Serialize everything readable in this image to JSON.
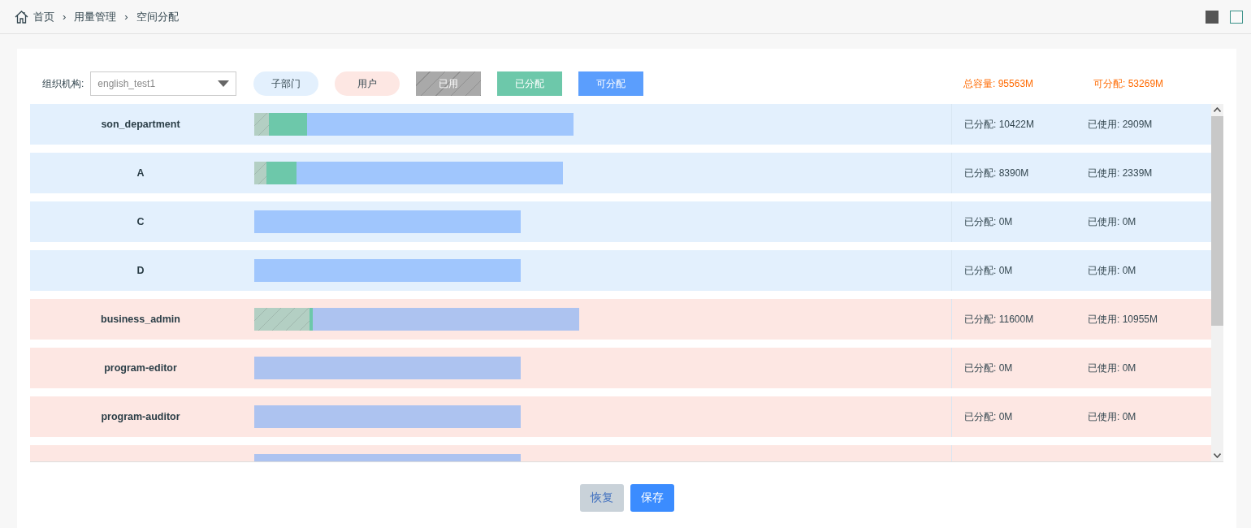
{
  "breadcrumb": [
    {
      "label": "首页"
    },
    {
      "label": "用量管理"
    },
    {
      "label": "空间分配"
    }
  ],
  "breadcrumb_separator": "›",
  "view_toggle": [
    {
      "selected": true
    },
    {
      "selected": false
    }
  ],
  "org_select": {
    "label": "组织机构:",
    "value": "english_test1"
  },
  "legend": [
    {
      "kind": "department",
      "label": "子部门"
    },
    {
      "kind": "user",
      "label": "用户"
    },
    {
      "kind": "used",
      "label": "已用"
    },
    {
      "kind": "allocated",
      "label": "已分配"
    },
    {
      "kind": "available",
      "label": "可分配"
    }
  ],
  "totals": [
    {
      "label": "总容量:",
      "value": "95563M"
    },
    {
      "label": "可分配:",
      "value": "53269M"
    }
  ],
  "rows": [
    {
      "kind": "department",
      "name": "son_department",
      "segments": [
        {
          "kind": "used"
        },
        {
          "kind": "allocated"
        },
        {
          "kind": "available"
        }
      ],
      "allocated": "已分配: 10422M",
      "used": "已使用: 2909M"
    },
    {
      "kind": "department",
      "name": "A",
      "segments": [
        {
          "kind": "used"
        },
        {
          "kind": "allocated"
        },
        {
          "kind": "available"
        }
      ],
      "allocated": "已分配: 8390M",
      "used": "已使用: 2339M"
    },
    {
      "kind": "department",
      "name": "C",
      "segments": [
        {
          "kind": "available"
        }
      ],
      "allocated": "已分配: 0M",
      "used": "已使用: 0M"
    },
    {
      "kind": "department",
      "name": "D",
      "segments": [
        {
          "kind": "available"
        }
      ],
      "allocated": "已分配: 0M",
      "used": "已使用: 0M"
    },
    {
      "kind": "user",
      "name": "business_admin",
      "segments": [
        {
          "kind": "used"
        },
        {
          "kind": "allocated"
        },
        {
          "kind": "available"
        }
      ],
      "allocated": "已分配: 11600M",
      "used": "已使用: 10955M"
    },
    {
      "kind": "user",
      "name": "program-editor",
      "segments": [
        {
          "kind": "available"
        }
      ],
      "allocated": "已分配: 0M",
      "used": "已使用: 0M"
    },
    {
      "kind": "user",
      "name": "program-auditor",
      "segments": [
        {
          "kind": "available"
        }
      ],
      "allocated": "已分配: 0M",
      "used": "已使用: 0M"
    },
    {
      "kind": "user",
      "segments": [
        {
          "kind": "available"
        }
      ]
    }
  ],
  "buttons": [
    {
      "label": "恢复",
      "disabled": true
    },
    {
      "label": "保存",
      "disabled": false
    }
  ]
}
